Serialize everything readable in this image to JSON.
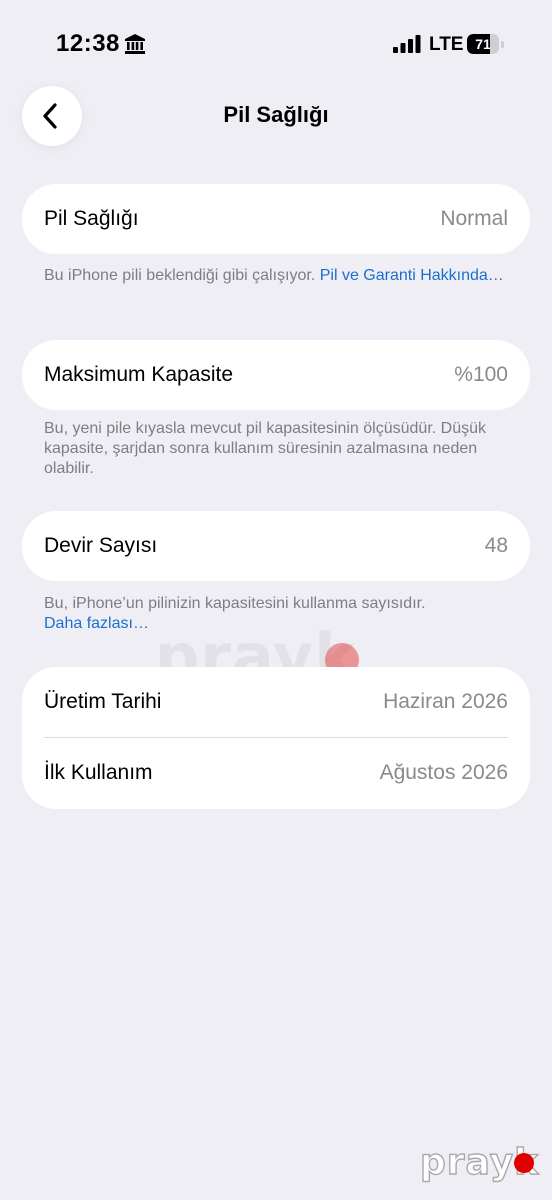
{
  "status_bar": {
    "time": "12:38",
    "network": "LTE",
    "battery_level": "71",
    "battery_fraction": 0.71,
    "icons": [
      "bank-icon",
      "signal-icon",
      "battery-icon"
    ]
  },
  "header": {
    "back_icon": "chevron-left-icon",
    "title": "Pil Sağlığı"
  },
  "sections": {
    "health": {
      "label": "Pil Sağlığı",
      "value": "Normal",
      "footnote_text": "Bu iPhone pili beklendiği gibi çalışıyor. ",
      "footnote_link": "Pil ve Garanti Hakkında…"
    },
    "capacity": {
      "label": "Maksimum Kapasite",
      "value": "%100",
      "footnote_text": "Bu, yeni pile kıyasla mevcut pil kapasitesinin ölçüsüdür. Düşük kapasite, şarjdan sonra kullanım süresinin azalmasına neden olabilir."
    },
    "cycles": {
      "label": "Devir Sayısı",
      "value": "48",
      "footnote_text": "Bu, iPhone’un pilinizin kapasitesini kullanma sayısıdır.",
      "footnote_link": "Daha fazlası…"
    },
    "dates": {
      "manufacture_label": "Üretim Tarihi",
      "manufacture_value": "Haziran 2026",
      "first_use_label": "İlk Kullanım",
      "first_use_value": "Ağustos 2026"
    }
  },
  "watermark": {
    "text": "prayk"
  },
  "colors": {
    "background": "#efeef5",
    "card": "#ffffff",
    "link": "#1a6fce",
    "secondary_text": "#8a8a8e"
  }
}
